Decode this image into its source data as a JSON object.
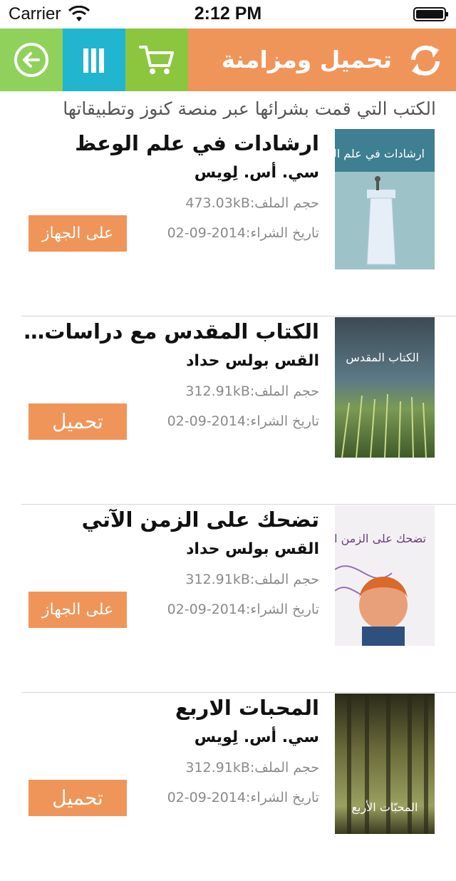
{
  "status_bar": {
    "carrier": "Carrier",
    "time": "2:12 PM"
  },
  "header": {
    "title": "تحميل ومزامنة",
    "buttons": [
      "back-icon",
      "library-icon",
      "cart-icon",
      "sync-icon"
    ],
    "colors": {
      "back": "#8fd15a",
      "library": "#22b5cf",
      "cart": "#8cc63f",
      "bar": "#f0955a"
    }
  },
  "subtitle": "الكتب التي قمت بشرائها عبر منصة كنوز وتطبيقاتها",
  "books": [
    {
      "title": "ارشادات في علم الوعظ",
      "author": "سي. أس. لِويس",
      "size": "حجم الملف:473.03kB",
      "date": "تاريخ الشراء:2014-09-02",
      "action": "على الجهاز",
      "cover_text": "ارشادات في علم الوعظ"
    },
    {
      "title": "الكتاب المقدس مع دراسات للنمو...",
      "author": "القس بولس حداد",
      "size": "حجم الملف:312.91kB",
      "date": "تاريخ الشراء:2014-09-02",
      "action": "تحميل",
      "cover_text": "الكتاب المقدس"
    },
    {
      "title": "تضحك على الزمن الآتي",
      "author": "القس بولس حداد",
      "size": "حجم الملف:312.91kB",
      "date": "تاريخ الشراء:2014-09-02",
      "action": "على الجهاز",
      "cover_text": "تضحك على الزمن الآتي"
    },
    {
      "title": "المحبات الاربع",
      "author": "سي. أس. لِويس",
      "size": "حجم الملف:312.91kB",
      "date": "تاريخ الشراء:2014-09-02",
      "action": "تحميل",
      "cover_text": "المحبّات الأربع"
    }
  ]
}
